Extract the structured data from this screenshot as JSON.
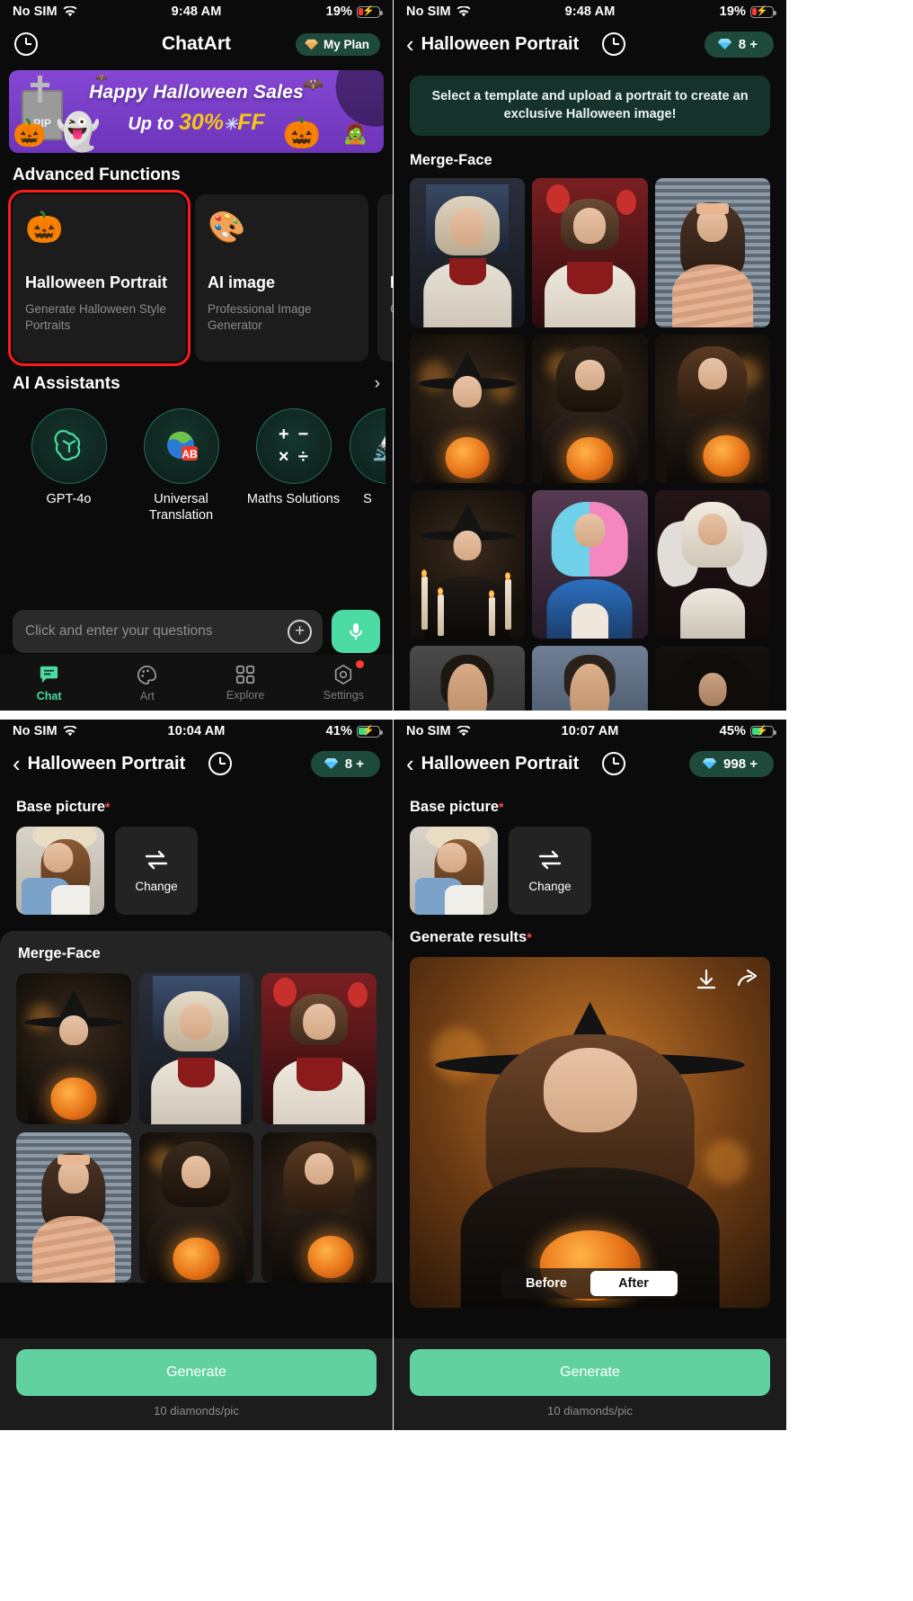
{
  "screens": {
    "home": {
      "status": {
        "carrier": "No SIM",
        "time": "9:48 AM",
        "battery": "19%"
      },
      "nav": {
        "title": "ChatArt",
        "history_icon": "clock-icon",
        "plan_label": "My Plan"
      },
      "banner": {
        "line1": "Happy Halloween Sales",
        "line2_prefix": "Up to ",
        "percent": "30%",
        "suffix": "FF"
      },
      "advanced": {
        "heading": "Advanced Functions",
        "cards": [
          {
            "icon": "pumpkin-icon",
            "title": "Halloween Portrait",
            "desc": "Generate Halloween Style Portraits",
            "selected": true
          },
          {
            "icon": "palette-icon",
            "title": "AI image",
            "desc": "Professional Image Generator",
            "selected": false
          },
          {
            "icon": "image-icon",
            "title": "Im",
            "desc": "Ch",
            "selected": false
          }
        ]
      },
      "assistants": {
        "heading": "AI Assistants",
        "more_icon": "chevron-right-icon",
        "items": [
          {
            "icon": "openai-icon",
            "label": "GPT-4o"
          },
          {
            "icon": "globe-ab-icon",
            "label": "Universal Translation"
          },
          {
            "icon": "math-symbols-icon",
            "label": "Maths Solutions"
          },
          {
            "icon": "science-icon",
            "label": "S"
          }
        ]
      },
      "composer": {
        "placeholder": "Click and enter your questions",
        "add_icon": "plus-circle-icon",
        "mic_icon": "microphone-icon"
      },
      "tabs": [
        {
          "icon": "chat-bubble-icon",
          "label": "Chat",
          "active": true,
          "badge": false
        },
        {
          "icon": "palette-icon",
          "label": "Art",
          "active": false,
          "badge": false
        },
        {
          "icon": "grid-icon",
          "label": "Explore",
          "active": false,
          "badge": false
        },
        {
          "icon": "gear-icon",
          "label": "Settings",
          "active": false,
          "badge": true
        }
      ]
    },
    "templates": {
      "status": {
        "carrier": "No SIM",
        "time": "9:48 AM",
        "battery": "19%"
      },
      "nav": {
        "back_icon": "chevron-left-icon",
        "title": "Halloween Portrait",
        "history_icon": "clock-icon",
        "coins": "8 +"
      },
      "tip": "Select a template and upload a portrait to create an exclusive Halloween image!",
      "group_title": "Merge-Face",
      "template_rows": [
        [
          "bride-stained-glass",
          "bloody-balloons",
          "mummy-blinds"
        ],
        [
          "witch-hat-pumpkin",
          "dark-witch-pumpkin",
          "witch-pumpkin-glow"
        ],
        [
          "witch-candles",
          "pink-hair-harley",
          "angel-wings-white"
        ],
        [
          "man-portrait-1",
          "man-portrait-2",
          "dark-figure"
        ]
      ]
    },
    "picker": {
      "status": {
        "carrier": "No SIM",
        "time": "10:04 AM",
        "battery": "41%"
      },
      "nav": {
        "back_icon": "chevron-left-icon",
        "title": "Halloween Portrait",
        "history_icon": "clock-icon",
        "coins": "8 +"
      },
      "base_label": "Base picture",
      "required_mark": "*",
      "change_label": "Change",
      "change_icon": "swap-icon",
      "merge_title": "Merge-Face",
      "merge_rows": [
        [
          "witch-hat-pumpkin",
          "bride-stained-glass",
          "bloody-balloons"
        ],
        [
          "mummy-blinds",
          "dark-witch-pumpkin",
          "witch-pumpkin-glow"
        ]
      ],
      "generate_label": "Generate",
      "generate_sub": "10 diamonds/pic"
    },
    "result": {
      "status": {
        "carrier": "No SIM",
        "time": "10:07 AM",
        "battery": "45%"
      },
      "nav": {
        "back_icon": "chevron-left-icon",
        "title": "Halloween Portrait",
        "history_icon": "clock-icon",
        "coins": "998 +"
      },
      "base_label": "Base picture",
      "required_mark": "*",
      "change_label": "Change",
      "change_icon": "swap-icon",
      "results_label": "Generate results",
      "download_icon": "download-icon",
      "share_icon": "share-icon",
      "toggle": {
        "before": "Before",
        "after": "After",
        "selected": "After"
      },
      "generate_label": "Generate",
      "generate_sub": "10 diamonds/pic"
    }
  },
  "colors": {
    "accent_green": "#4ddba4",
    "generate_green": "#62d1a0",
    "pill_green": "#1e4a3c",
    "highlight_red": "#ff1a1a",
    "banner_purple": "#7a3fc8",
    "banner_yellow": "#f5c518"
  }
}
